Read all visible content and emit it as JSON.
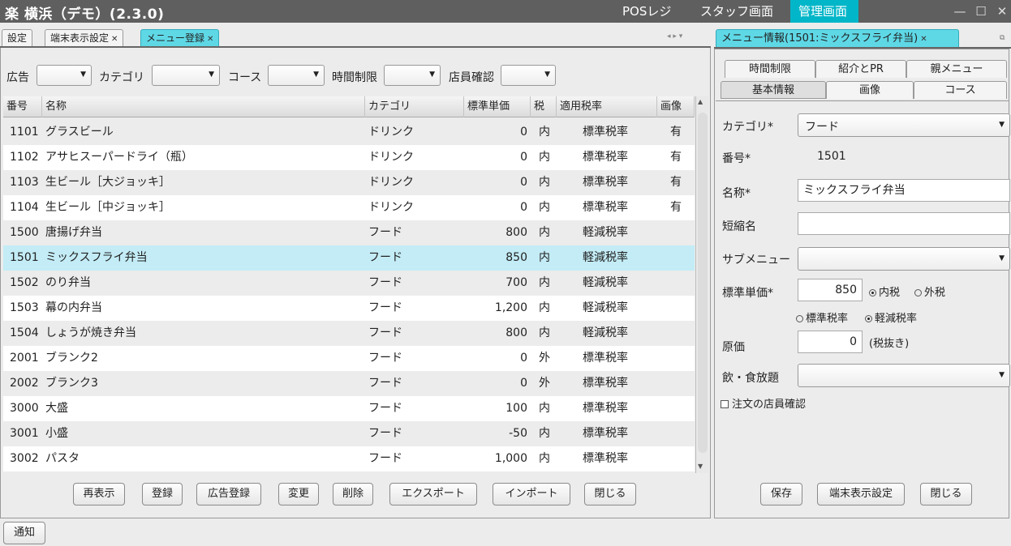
{
  "app": {
    "title": "楽 横浜（デモ）(2.3.0)",
    "nav": [
      "POSレジ",
      "スタッフ画面",
      "管理画面"
    ],
    "win_buttons": [
      "—",
      "☐",
      "✕"
    ]
  },
  "left_tabs": [
    {
      "label": "設定",
      "closable": false
    },
    {
      "label": "端末表示設定",
      "closable": true
    },
    {
      "label": "メニュー登録",
      "closable": true,
      "active": true
    }
  ],
  "filters": {
    "ad": "広告",
    "category": "カテゴリ",
    "course": "コース",
    "time_limit": "時間制限",
    "staff_confirm": "店員確認"
  },
  "table": {
    "headers": [
      "番号",
      "名称",
      "カテゴリ",
      "標準単価",
      "税",
      "適用税率",
      "画像"
    ],
    "rows": [
      {
        "no": "1101",
        "name": "グラスビール",
        "cat": "ドリンク",
        "price": "0",
        "tax": "内",
        "rate": "標準税率",
        "img": "有"
      },
      {
        "no": "1102",
        "name": "アサヒスーパードライ（瓶）",
        "cat": "ドリンク",
        "price": "0",
        "tax": "内",
        "rate": "標準税率",
        "img": "有"
      },
      {
        "no": "1103",
        "name": "生ビール［大ジョッキ］",
        "cat": "ドリンク",
        "price": "0",
        "tax": "内",
        "rate": "標準税率",
        "img": "有"
      },
      {
        "no": "1104",
        "name": "生ビール［中ジョッキ］",
        "cat": "ドリンク",
        "price": "0",
        "tax": "内",
        "rate": "標準税率",
        "img": "有"
      },
      {
        "no": "1500",
        "name": "唐揚げ弁当",
        "cat": "フード",
        "price": "800",
        "tax": "内",
        "rate": "軽減税率",
        "img": ""
      },
      {
        "no": "1501",
        "name": "ミックスフライ弁当",
        "cat": "フード",
        "price": "850",
        "tax": "内",
        "rate": "軽減税率",
        "img": ""
      },
      {
        "no": "1502",
        "name": "のり弁当",
        "cat": "フード",
        "price": "700",
        "tax": "内",
        "rate": "軽減税率",
        "img": ""
      },
      {
        "no": "1503",
        "name": "幕の内弁当",
        "cat": "フード",
        "price": "1,200",
        "tax": "内",
        "rate": "軽減税率",
        "img": ""
      },
      {
        "no": "1504",
        "name": "しょうが焼き弁当",
        "cat": "フード",
        "price": "800",
        "tax": "内",
        "rate": "軽減税率",
        "img": ""
      },
      {
        "no": "2001",
        "name": "ブランク2",
        "cat": "フード",
        "price": "0",
        "tax": "外",
        "rate": "標準税率",
        "img": ""
      },
      {
        "no": "2002",
        "name": "ブランク3",
        "cat": "フード",
        "price": "0",
        "tax": "外",
        "rate": "標準税率",
        "img": ""
      },
      {
        "no": "3000",
        "name": "大盛",
        "cat": "フード",
        "price": "100",
        "tax": "内",
        "rate": "標準税率",
        "img": ""
      },
      {
        "no": "3001",
        "name": "小盛",
        "cat": "フード",
        "price": "-50",
        "tax": "内",
        "rate": "標準税率",
        "img": ""
      },
      {
        "no": "3002",
        "name": "パスタ",
        "cat": "フード",
        "price": "1,000",
        "tax": "内",
        "rate": "標準税率",
        "img": ""
      }
    ],
    "selected_index": 5
  },
  "left_buttons": [
    "再表示",
    "登録",
    "広告登録",
    "変更",
    "削除",
    "エクスポート",
    "インポート",
    "閉じる"
  ],
  "right": {
    "tab_label": "メニュー情報(1501:ミックスフライ弁当)",
    "sub_tabs_row1": [
      "時間制限",
      "紹介とPR",
      "親メニュー"
    ],
    "sub_tabs_row2": [
      "基本情報",
      "画像",
      "コース"
    ],
    "labels": {
      "category": "カテゴリ*",
      "number": "番号*",
      "name": "名称*",
      "short_name": "短縮名",
      "submenu": "サブメニュー",
      "price": "標準単価*",
      "cost": "原価",
      "all_you_can": "飲・食放題",
      "staff_confirm": "注文の店員確認"
    },
    "values": {
      "category": "フード",
      "number": "1501",
      "name": "ミックスフライ弁当",
      "short_name": "",
      "price": "850",
      "cost": "0",
      "cost_note": "(税抜き)"
    },
    "tax_options": {
      "inclusive": "内税",
      "exclusive": "外税",
      "selected": "inclusive"
    },
    "rate_options": {
      "standard": "標準税率",
      "reduced": "軽減税率",
      "selected": "reduced"
    },
    "buttons": [
      "保存",
      "端末表示設定",
      "閉じる"
    ]
  },
  "footer": {
    "notify": "通知"
  },
  "colors": {
    "accent": "#00b6c8",
    "selected_row": "#c3ecf6",
    "titlebar": "#5f5f5f"
  }
}
